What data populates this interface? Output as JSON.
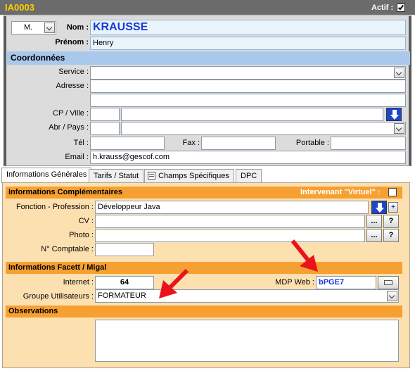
{
  "header": {
    "record_id": "IA0003",
    "actif_label": "Actif :",
    "actif_checked": true
  },
  "identity": {
    "civility": "M.",
    "nom_label": "Nom :",
    "nom_value": "KRAUSSE",
    "prenom_label": "Prénom :",
    "prenom_value": "Henry"
  },
  "coordonnees": {
    "title": "Coordonnées",
    "service_label": "Service :",
    "adresse_label": "Adresse :",
    "cp_ville_label": "CP / Ville :",
    "abr_pays_label": "Abr / Pays :",
    "tel_label": "Tél :",
    "fax_label": "Fax :",
    "portable_label": "Portable :",
    "email_label": "Email :",
    "email_value": "h.krauss@gescof.com"
  },
  "tabs": [
    {
      "label": "Informations Générales"
    },
    {
      "label": "Tarifs / Statut"
    },
    {
      "label": "Champs Spécifiques"
    },
    {
      "label": "DPC"
    }
  ],
  "infos_complementaires": {
    "title": "Informations Complémentaires",
    "intervenant_label": "Intervenant \"Virtuel\" :",
    "fonction_label": "Fonction - Profession :",
    "fonction_value": "Développeur Java",
    "plus_label": "+",
    "cv_label": "CV :",
    "photo_label": "Photo :",
    "comptable_label": "N° Comptable :",
    "dots_label": "...",
    "help_label": "?"
  },
  "facett": {
    "title": "Informations Facett / Migal",
    "internet_label": "Internet :",
    "internet_value": "64",
    "mdp_label": "MDP Web :",
    "mdp_value": "bPGE7",
    "groupe_label": "Groupe Utilisateurs :",
    "groupe_value": "FORMATEUR"
  },
  "observations": {
    "title": "Observations"
  },
  "colors": {
    "accent_orange": "#f6a032",
    "section_blue": "#a9c8ec",
    "arrow_red": "#e8141a",
    "title_blue": "#1a3ad6"
  }
}
